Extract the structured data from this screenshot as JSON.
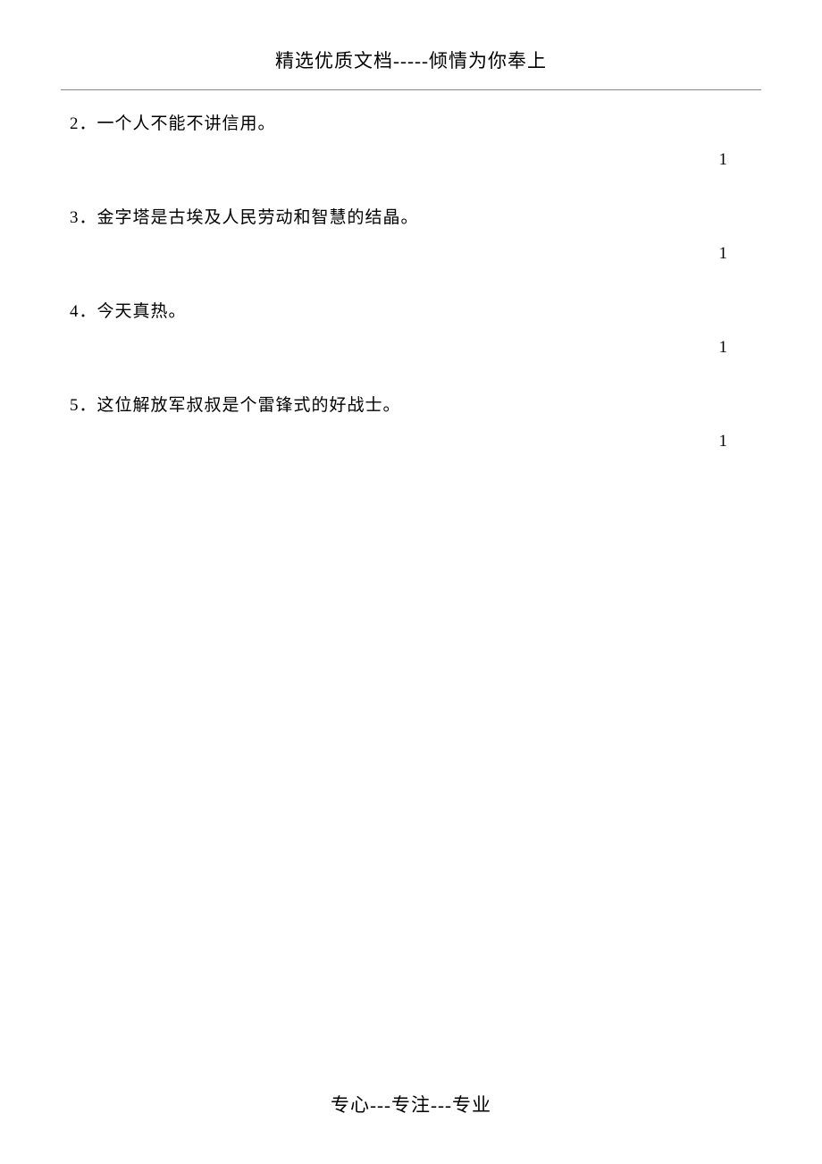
{
  "header": {
    "title": "精选优质文档-----倾情为你奉上"
  },
  "items": [
    {
      "text": "2．一个人不能不讲信用。",
      "mark": "1"
    },
    {
      "text": "3．金字塔是古埃及人民劳动和智慧的结晶。",
      "mark": "1"
    },
    {
      "text": "4．今天真热。",
      "mark": "1"
    },
    {
      "text": "5．这位解放军叔叔是个雷锋式的好战士。",
      "mark": "1"
    }
  ],
  "footer": {
    "text": "专心---专注---专业"
  }
}
